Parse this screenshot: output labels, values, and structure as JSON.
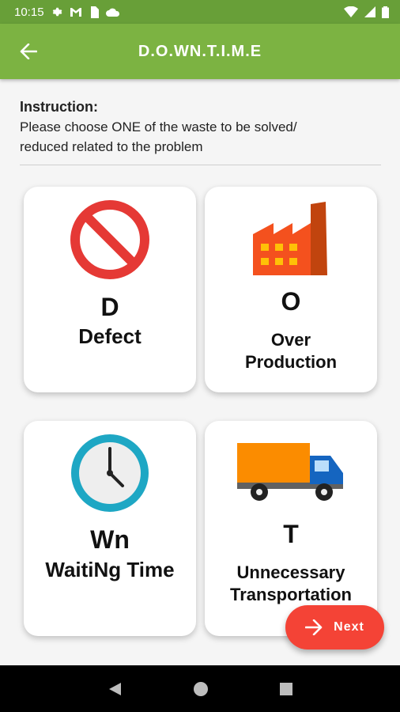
{
  "status": {
    "time": "10:15"
  },
  "appbar": {
    "title": "D.O.WN.T.I.M.E"
  },
  "instruction": {
    "heading": "Instruction:",
    "line1": "Please choose ONE of the waste to be solved/",
    "line2": "reduced related to the problem"
  },
  "cards": [
    {
      "letter": "D",
      "label": "Defect",
      "icon": "no-entry-icon"
    },
    {
      "letter": "O",
      "label_line1": "Over",
      "label_line2": "Production",
      "icon": "factory-icon"
    },
    {
      "letter": "Wn",
      "label": "WaitiNg Time",
      "icon": "clock-icon"
    },
    {
      "letter": "T",
      "label_line1": "Unnecessary",
      "label_line2": "Transportation",
      "icon": "truck-icon"
    }
  ],
  "fab": {
    "label": "Next"
  },
  "colors": {
    "primary": "#7cb342",
    "primary_dark": "#689f38",
    "accent": "#f44336"
  }
}
